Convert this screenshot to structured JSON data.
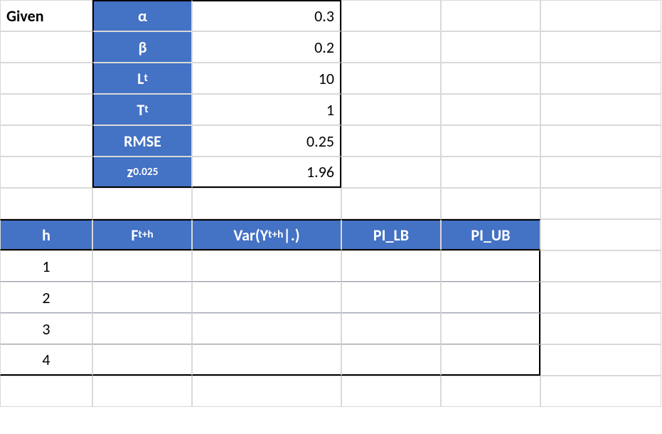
{
  "given_label": "Given",
  "params": {
    "alpha": {
      "label": "α",
      "value": "0.3"
    },
    "beta": {
      "label": "β",
      "value": "0.2"
    },
    "Lt": {
      "label_html": "L<sub>t</sub>",
      "label": "Lt",
      "value": "10"
    },
    "Tt": {
      "label_html": "T<sub>t</sub>",
      "label": "Tt",
      "value": "1"
    },
    "rmse": {
      "label": "RMSE",
      "value": "0.25"
    },
    "z": {
      "label_html": "z<sub>0.025</sub>",
      "label": "z0.025",
      "value": "1.96"
    }
  },
  "table": {
    "headers": {
      "h": "h",
      "F": "Ft+h",
      "F_html": "F<sub>t+h</sub>",
      "Var": "Var(Yt+h|.)",
      "Var_html": "Var(Y<sub>t+h</sub>|.)",
      "PI_LB": "PI_LB",
      "PI_UB": "PI_UB"
    },
    "rows": [
      {
        "h": "1",
        "F": "",
        "Var": "",
        "PI_LB": "",
        "PI_UB": ""
      },
      {
        "h": "2",
        "F": "",
        "Var": "",
        "PI_LB": "",
        "PI_UB": ""
      },
      {
        "h": "3",
        "F": "",
        "Var": "",
        "PI_LB": "",
        "PI_UB": ""
      },
      {
        "h": "4",
        "F": "",
        "Var": "",
        "PI_LB": "",
        "PI_UB": ""
      }
    ]
  }
}
